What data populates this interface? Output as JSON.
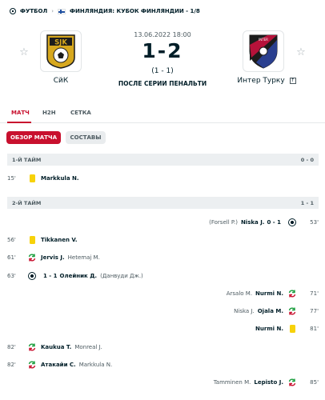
{
  "breadcrumb": {
    "sport": "ФУТБОЛ",
    "competition": "ФИНЛЯНДИЯ: КУБОК ФИНЛЯНДИИ - 1/8"
  },
  "match": {
    "datetime": "13.06.2022 18:00",
    "score": "1-2",
    "aggregate": "(1 - 1)",
    "status": "ПОСЛЕ СЕРИИ ПЕНАЛЬТИ",
    "home": {
      "name": "СйК",
      "logo_text": "SJK"
    },
    "away": {
      "name": "Интер Турку"
    }
  },
  "tabs": [
    "МАТЧ",
    "H2H",
    "СЕТКА"
  ],
  "subtabs": [
    "ОБЗОР МАТЧА",
    "СОСТАВЫ"
  ],
  "periods": [
    {
      "label": "1-Й ТАЙМ",
      "score": "0 - 0"
    },
    {
      "label": "2-Й ТАЙМ",
      "score": "1 - 1"
    }
  ],
  "incidents": [
    {
      "side": "home",
      "minute": "15'",
      "type": "yellow-card",
      "player": "Markkula N.",
      "secondary": ""
    },
    {
      "side": "away",
      "minute": "53'",
      "type": "goal",
      "player": "Niska J.",
      "secondary": "(Forsell P.)",
      "goal_score": "0 - 1"
    },
    {
      "side": "home",
      "minute": "56'",
      "type": "yellow-card",
      "player": "Tikkanen V.",
      "secondary": ""
    },
    {
      "side": "home",
      "minute": "61'",
      "type": "substitution",
      "player": "Jervis J.",
      "secondary": "Hetemaj M."
    },
    {
      "side": "home",
      "minute": "63'",
      "type": "goal",
      "player": "Олейник Д.",
      "secondary": "(Данвуди Дж.)",
      "goal_score": "1 - 1"
    },
    {
      "side": "away",
      "minute": "71'",
      "type": "substitution",
      "player": "Nurmi N.",
      "secondary": "Arsalo M."
    },
    {
      "side": "away",
      "minute": "77'",
      "type": "substitution",
      "player": "Ojala M.",
      "secondary": "Niska J."
    },
    {
      "side": "away",
      "minute": "81'",
      "type": "yellow-card",
      "player": "Nurmi N.",
      "secondary": ""
    },
    {
      "side": "home",
      "minute": "82'",
      "type": "substitution",
      "player": "Kaukua T.",
      "secondary": "Monreal J."
    },
    {
      "side": "home",
      "minute": "82'",
      "type": "substitution",
      "player": "Атакайи С.",
      "secondary": "Markkula N."
    },
    {
      "side": "away",
      "minute": "85'",
      "type": "substitution",
      "player": "Lepisto J.",
      "secondary": "Tamminen M."
    }
  ]
}
